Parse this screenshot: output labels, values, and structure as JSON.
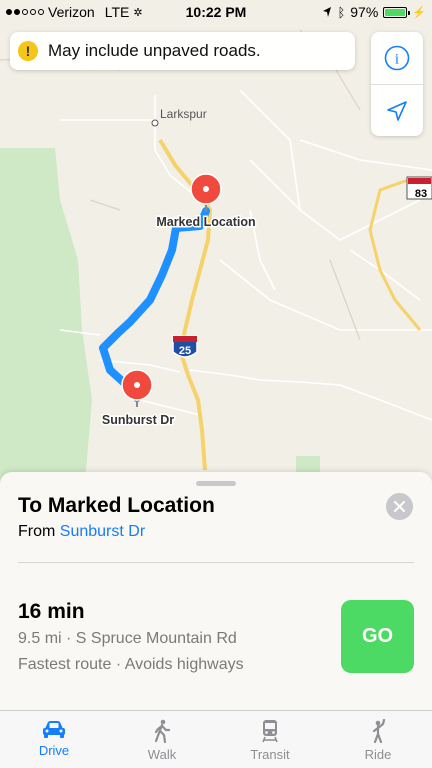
{
  "status_bar": {
    "carrier": "Verizon",
    "network": "LTE",
    "time": "10:22 PM",
    "battery": "97%",
    "battery_level": 0.97
  },
  "banner": {
    "icon": "!",
    "text": "May include unpaved roads."
  },
  "map_controls": {
    "info_icon": "i",
    "location_icon": "location-arrow-icon"
  },
  "map": {
    "places": {
      "larkspur": "Larkspur",
      "marked_location": "Marked Location",
      "sunburst": "Sunburst Dr"
    },
    "shields": {
      "interstate": "25",
      "state": "83"
    },
    "colors": {
      "route": "#1e90ff",
      "pin": "#f04a3e",
      "road": "#f6d26b",
      "park": "#cfe8c5"
    }
  },
  "sheet": {
    "title": "To Marked Location",
    "from_prefix": "From",
    "from_place": "Sunburst Dr",
    "close_icon": "close-icon",
    "route": {
      "time": "16 min",
      "detail": "9.5 mi · S Spruce Mountain Rd",
      "note": "Fastest route · Avoids highways",
      "go_label": "GO"
    }
  },
  "tabs": [
    {
      "label": "Drive",
      "icon": "car-icon",
      "active": true
    },
    {
      "label": "Walk",
      "icon": "walk-icon",
      "active": false
    },
    {
      "label": "Transit",
      "icon": "train-icon",
      "active": false
    },
    {
      "label": "Ride",
      "icon": "ride-icon",
      "active": false
    }
  ],
  "colors": {
    "accent": "#147efb",
    "go": "#4cd964",
    "warning": "#f5c518"
  }
}
